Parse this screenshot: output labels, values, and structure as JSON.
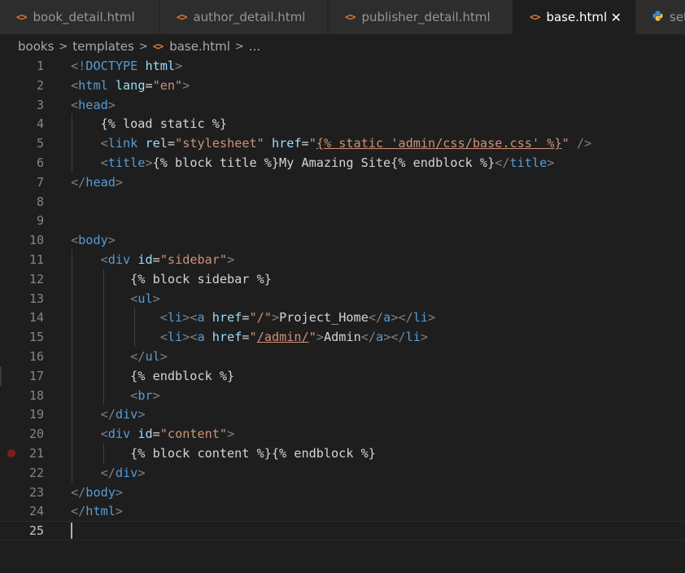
{
  "tabs": [
    {
      "label": "book_detail.html",
      "icon": "html-file-icon",
      "active": false
    },
    {
      "label": "author_detail.html",
      "icon": "html-file-icon",
      "active": false
    },
    {
      "label": "publisher_detail.html",
      "icon": "html-file-icon",
      "active": false
    },
    {
      "label": "base.html",
      "icon": "html-file-icon",
      "active": true
    },
    {
      "label": "setti",
      "icon": "python-file-icon",
      "active": false
    }
  ],
  "tab_close_glyph": "✕",
  "tab_icon_glyph": "<>",
  "breadcrumb": {
    "items": [
      "books",
      "templates",
      "base.html",
      "..."
    ],
    "separator": ">"
  },
  "editor": {
    "current_line": 25,
    "breakpoint_line": 21,
    "lines": [
      [
        [
          "br",
          "<!"
        ],
        [
          "tag",
          "DOCTYPE"
        ],
        [
          "txt",
          " "
        ],
        [
          "attr",
          "html"
        ],
        [
          "br",
          ">"
        ]
      ],
      [
        [
          "br",
          "<"
        ],
        [
          "tag",
          "html"
        ],
        [
          "txt",
          " "
        ],
        [
          "attr",
          "lang"
        ],
        [
          "txt",
          "="
        ],
        [
          "str",
          "\"en\""
        ],
        [
          "br",
          ">"
        ]
      ],
      [
        [
          "br",
          "<"
        ],
        [
          "tag",
          "head"
        ],
        [
          "br",
          ">"
        ]
      ],
      [
        [
          "txt",
          "    {% load static %}"
        ]
      ],
      [
        [
          "txt",
          "    "
        ],
        [
          "br",
          "<"
        ],
        [
          "tag",
          "link"
        ],
        [
          "txt",
          " "
        ],
        [
          "attr",
          "rel"
        ],
        [
          "txt",
          "="
        ],
        [
          "str",
          "\"stylesheet\""
        ],
        [
          "txt",
          " "
        ],
        [
          "attr",
          "href"
        ],
        [
          "txt",
          "="
        ],
        [
          "str",
          "\""
        ],
        [
          "strul",
          "{% static 'admin/css/base.css' %}"
        ],
        [
          "str",
          "\""
        ],
        [
          "txt",
          " "
        ],
        [
          "br",
          "/>"
        ]
      ],
      [
        [
          "txt",
          "    "
        ],
        [
          "br",
          "<"
        ],
        [
          "tag",
          "title"
        ],
        [
          "br",
          ">"
        ],
        [
          "txt",
          "{% block title %}My Amazing Site{% endblock %}"
        ],
        [
          "br",
          "</"
        ],
        [
          "tag",
          "title"
        ],
        [
          "br",
          ">"
        ]
      ],
      [
        [
          "br",
          "</"
        ],
        [
          "tag",
          "head"
        ],
        [
          "br",
          ">"
        ]
      ],
      [],
      [],
      [
        [
          "br",
          "<"
        ],
        [
          "tag",
          "body"
        ],
        [
          "br",
          ">"
        ]
      ],
      [
        [
          "txt",
          "    "
        ],
        [
          "br",
          "<"
        ],
        [
          "tag",
          "div"
        ],
        [
          "txt",
          " "
        ],
        [
          "attr",
          "id"
        ],
        [
          "txt",
          "="
        ],
        [
          "str",
          "\"sidebar\""
        ],
        [
          "br",
          ">"
        ]
      ],
      [
        [
          "txt",
          "        {% block sidebar %}"
        ]
      ],
      [
        [
          "txt",
          "        "
        ],
        [
          "br",
          "<"
        ],
        [
          "tag",
          "ul"
        ],
        [
          "br",
          ">"
        ]
      ],
      [
        [
          "txt",
          "            "
        ],
        [
          "br",
          "<"
        ],
        [
          "tag",
          "li"
        ],
        [
          "br",
          "><"
        ],
        [
          "tag",
          "a"
        ],
        [
          "txt",
          " "
        ],
        [
          "attr",
          "href"
        ],
        [
          "txt",
          "="
        ],
        [
          "str",
          "\"/\""
        ],
        [
          "br",
          ">"
        ],
        [
          "txt",
          "Project_Home"
        ],
        [
          "br",
          "</"
        ],
        [
          "tag",
          "a"
        ],
        [
          "br",
          "></"
        ],
        [
          "tag",
          "li"
        ],
        [
          "br",
          ">"
        ]
      ],
      [
        [
          "txt",
          "            "
        ],
        [
          "br",
          "<"
        ],
        [
          "tag",
          "li"
        ],
        [
          "br",
          "><"
        ],
        [
          "tag",
          "a"
        ],
        [
          "txt",
          " "
        ],
        [
          "attr",
          "href"
        ],
        [
          "txt",
          "="
        ],
        [
          "str",
          "\""
        ],
        [
          "strul",
          "/admin/"
        ],
        [
          "str",
          "\""
        ],
        [
          "br",
          ">"
        ],
        [
          "txt",
          "Admin"
        ],
        [
          "br",
          "</"
        ],
        [
          "tag",
          "a"
        ],
        [
          "br",
          "></"
        ],
        [
          "tag",
          "li"
        ],
        [
          "br",
          ">"
        ]
      ],
      [
        [
          "txt",
          "        "
        ],
        [
          "br",
          "</"
        ],
        [
          "tag",
          "ul"
        ],
        [
          "br",
          ">"
        ]
      ],
      [
        [
          "txt",
          "        {% endblock %}"
        ]
      ],
      [
        [
          "txt",
          "        "
        ],
        [
          "br",
          "<"
        ],
        [
          "tag",
          "br"
        ],
        [
          "br",
          ">"
        ]
      ],
      [
        [
          "txt",
          "    "
        ],
        [
          "br",
          "</"
        ],
        [
          "tag",
          "div"
        ],
        [
          "br",
          ">"
        ]
      ],
      [
        [
          "txt",
          "    "
        ],
        [
          "br",
          "<"
        ],
        [
          "tag",
          "div"
        ],
        [
          "txt",
          " "
        ],
        [
          "attr",
          "id"
        ],
        [
          "txt",
          "="
        ],
        [
          "str",
          "\"content\""
        ],
        [
          "br",
          ">"
        ]
      ],
      [
        [
          "txt",
          "        {% block content %}{% endblock %}"
        ]
      ],
      [
        [
          "txt",
          "    "
        ],
        [
          "br",
          "</"
        ],
        [
          "tag",
          "div"
        ],
        [
          "br",
          ">"
        ]
      ],
      [
        [
          "br",
          "</"
        ],
        [
          "tag",
          "body"
        ],
        [
          "br",
          ">"
        ]
      ],
      [
        [
          "br",
          "</"
        ],
        [
          "tag",
          "html"
        ],
        [
          "br",
          ">"
        ]
      ],
      []
    ]
  },
  "colors": {
    "background": "#1e1e1e",
    "tag": "#569cd6",
    "attribute": "#9cdcfe",
    "string": "#ce9178",
    "text": "#d4d4d4",
    "bracket": "#808080",
    "html_icon": "#e37933",
    "python_icon": "#3f8fd2",
    "breakpoint": "#7a1e1e"
  }
}
